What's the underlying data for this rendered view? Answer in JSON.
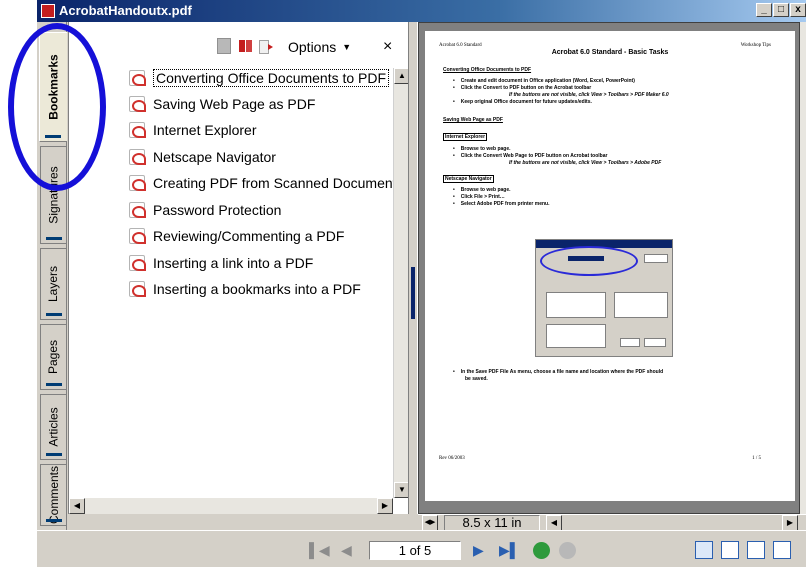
{
  "window": {
    "title": "AcrobatHandoutx.pdf",
    "controls": [
      "_",
      "□",
      "x"
    ]
  },
  "side_tabs": [
    {
      "label": "Bookmarks",
      "active": true
    },
    {
      "label": "Signatures",
      "active": false
    },
    {
      "label": "Layers",
      "active": false
    },
    {
      "label": "Pages",
      "active": false
    },
    {
      "label": "Articles",
      "active": false
    },
    {
      "label": "Comments",
      "active": false
    }
  ],
  "bookmarks_panel": {
    "options_label": "Options",
    "close_label": "×",
    "items": [
      {
        "label": "Converting Office Documents to PDF",
        "selected": true
      },
      {
        "label": "Saving Web Page as PDF",
        "selected": false
      },
      {
        "label": "Internet Explorer",
        "selected": false
      },
      {
        "label": "Netscape Navigator",
        "selected": false
      },
      {
        "label": "Creating PDF from Scanned Document",
        "selected": false
      },
      {
        "label": "Password Protection",
        "selected": false
      },
      {
        "label": "Reviewing/Commenting a PDF",
        "selected": false
      },
      {
        "label": "Inserting a link into a PDF",
        "selected": false
      },
      {
        "label": "Inserting a bookmarks into a PDF",
        "selected": false
      }
    ]
  },
  "document_page": {
    "header_left": "Acrobat 6.0 Standard",
    "header_right": "Workshop Tips",
    "title": "Acrobat 6.0 Standard  - Basic Tasks",
    "section1": "Converting Office Documents to PDF",
    "s1_bullets": [
      "Create and edit document in Office application (Word, Excel, PowerPoint)",
      "Click the Convert to PDF button on the Acrobat toolbar",
      "Keep original Office document for future updates/edits."
    ],
    "s1_note": "If the buttons are not visible, click View > Toolbars > PDF Maker 6.0",
    "section2": "Saving Web Page as PDF",
    "subsection_ie": "Internet Explorer",
    "ie_bullets": [
      "Browse to web page.",
      "Click the Convert Web Page to PDF button on Acrobat toolbar"
    ],
    "ie_note": "If the buttons are not visible, click View > Toolbars > Adobe PDF",
    "subsection_ns": "Netscape Navigator",
    "ns_bullets": [
      "Browse to web page.",
      "Click File > Print…",
      "Select Adobe PDF from printer menu."
    ],
    "final_bullet": "In the Save PDF File As menu, choose a file name and location where the PDF should",
    "final_bullet_cont": "be saved.",
    "footer_left": "Rev 06/2003",
    "footer_right": "1 / 5"
  },
  "doc_status": {
    "page_size": "8.5 x 11 in"
  },
  "status_bar": {
    "page_indicator": "1 of 5",
    "first_page_icon": "first-page-icon",
    "prev_page_icon": "previous-page-icon",
    "next_page_icon": "next-page-icon",
    "last_page_icon": "last-page-icon"
  },
  "colors": {
    "title_bar": "#0a246a",
    "annotation_oval": "#1510d8",
    "pdf_icon_red": "#d0312d",
    "nav_blue": "#2a5fb0",
    "go_back_green": "#2e9a3c"
  }
}
